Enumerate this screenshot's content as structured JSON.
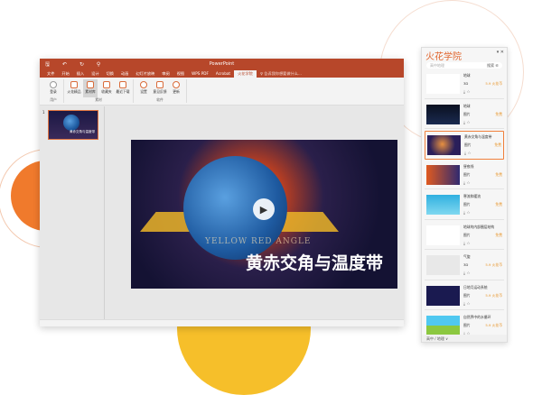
{
  "window": {
    "title": "PowerPoint",
    "quick_access": "🖫 ↶ ↻ ⚲"
  },
  "tabs": [
    "文件",
    "开始",
    "插入",
    "设计",
    "切换",
    "动画",
    "幻灯片放映",
    "审阅",
    "视图",
    "WPS PDF",
    "Acrobat",
    "火花学院"
  ],
  "tell_me": "♀ 告诉我你想要做什么...",
  "ribbon": {
    "groups": [
      {
        "label": "用户",
        "buttons": [
          "登录"
        ]
      },
      {
        "label": "素材",
        "buttons": [
          "火花精品",
          "素材库",
          "收藏夹",
          "最近下载"
        ]
      },
      {
        "label": "软件",
        "buttons": [
          "设置",
          "意见反馈",
          "更新"
        ]
      }
    ]
  },
  "slide_number": "1",
  "slide": {
    "title": "黄赤交角与温度带",
    "subtitle": "YELLOW RED ANGLE"
  },
  "panel": {
    "brand": "火花学院",
    "controls": "▾ ✕",
    "search_placeholder": "高中地理",
    "search_button": "搜索 ⑥",
    "items": [
      {
        "name": "地球",
        "type": "3D",
        "price": "5.9 火花币"
      },
      {
        "name": "地球",
        "type": "图片",
        "price": "免费"
      },
      {
        "name": "黄赤交角与温度带",
        "type": "图片",
        "price": "免费"
      },
      {
        "name": "昼夜线",
        "type": "图片",
        "price": "免费"
      },
      {
        "name": "寒流和暖流",
        "type": "图片",
        "price": "免费"
      },
      {
        "name": "地球的内部圈层结构",
        "type": "图片",
        "price": "免费"
      },
      {
        "name": "气旋",
        "type": "3D",
        "price": "5.9 火花币"
      },
      {
        "name": "日地月运动系统",
        "type": "图片",
        "price": "5.9 火花币"
      },
      {
        "name": "自然界中的水循环",
        "type": "图片",
        "price": "5.9 火花币"
      }
    ],
    "footer": "高中 / 地理 ∨"
  },
  "colors": {
    "accent": "#b7472a",
    "brand": "#e0642c"
  }
}
